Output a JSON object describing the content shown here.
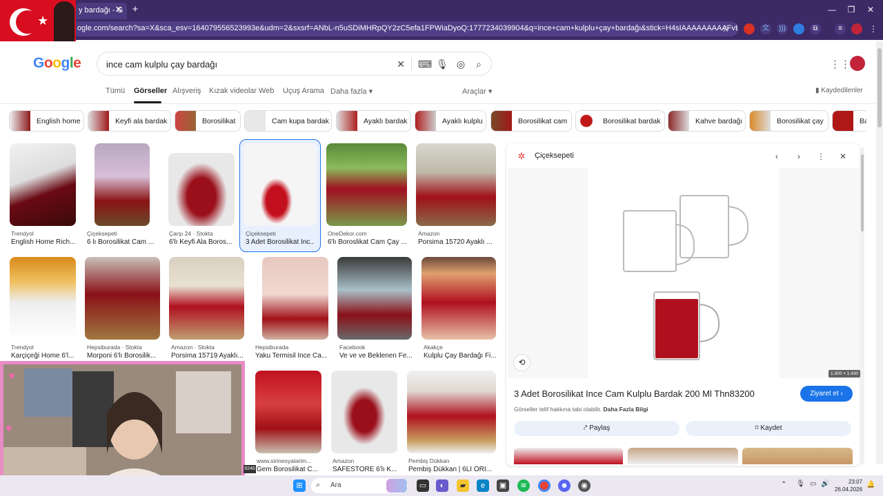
{
  "browser": {
    "tab_title": "y bardağı - G",
    "tab_close": "✕",
    "new_tab": "+",
    "url": "ogle.com/search?sa=X&sca_esv=164079556523993e&udm=2&sxsrf=ANbL-n5uSDiMHRpQY2zC5efa1FPWiaDyoQ:1777234039904&q=ince+cam+kulplu+çay+bardağı&stick=H4sIAAAAAAAAAFvEKpeZl5yqkJyYq5BdmlOQU6...",
    "win_minimize": "—",
    "win_restore": "❐",
    "win_close": "✕"
  },
  "google": {
    "logo_letters": [
      "G",
      "o",
      "o",
      "g",
      "l",
      "e"
    ],
    "logo_colors": [
      "#4285f4",
      "#ea4335",
      "#fbbc05",
      "#4285f4",
      "#34a853",
      "#ea4335"
    ],
    "query": "ince cam kulplu çay bardağı",
    "nav_tabs": [
      "Tümü",
      "Görseller",
      "Alışveriş",
      "Kızak videolar",
      "Web",
      "Uçuş Arama",
      "Daha fazla ▾"
    ],
    "tools": "Araçlar ▾",
    "saved": "Kaydedilenler"
  },
  "chips": [
    "English home",
    "Keyfi ala bardak",
    "Borosilikat",
    "Cam kupa bardak",
    "Ayaklı bardak",
    "Ayaklı kulplu",
    "Borosilikat cam",
    "Borosilikat bardak",
    "Kahve bardağı",
    "Borosilikat çay",
    "Ba"
  ],
  "results": [
    {
      "source": "Trendyol",
      "title": "English Home Rich..."
    },
    {
      "source": "Çiçeksepeti",
      "title": "6 lı Borosilikat Cam ..."
    },
    {
      "source": "Çarşı 24 · Stokta",
      "title": "6'lı Keyfi Ala Boros..."
    },
    {
      "source": "Çiçeksepeti",
      "title": "3 Adet Borosilikat Inc..."
    },
    {
      "source": "OneDekor.com",
      "title": "6'lı Boroslikat Cam Çay ..."
    },
    {
      "source": "Amazon",
      "title": "Porsima 15720 Ayaklı ..."
    },
    {
      "source": "Trendyol",
      "title": "Karçiçeği Home 6'l..."
    },
    {
      "source": "Hepsiburada · Stokta",
      "title": "Morponi 6'lı Borosilik..."
    },
    {
      "source": "Amazon · Stokta",
      "title": "Porsima 15719 Ayaklı..."
    },
    {
      "source": "Hepsiburada",
      "title": "Yaku Termisil Ince Ca..."
    },
    {
      "source": "Facebook",
      "title": "Ve ve ve Beklenen Fe..."
    },
    {
      "source": "Akakçe",
      "title": "Kulplu Çay Bardağı Fi..."
    },
    {
      "source": "www.sirinesyalarim...",
      "title": "Gem Borosilikat C..."
    },
    {
      "source": "Amazon",
      "title": "SAFESTORE 6'lı K..."
    },
    {
      "source": "Pembiş Dükkan",
      "title": "Pembiş Dükkan | 6LI ORİ..."
    }
  ],
  "panel": {
    "site": "Çiçeksepeti",
    "title": "3 Adet Borosilikat Ince Cam Kulplu Bardak 200 Ml Thn83200",
    "copyright": "Görseller telif hakkına tabi olabilir.",
    "more_info": "Daha Fazla Bilgi",
    "visit": "Ziyaret et ›",
    "share": "Paylaş",
    "save": "Kaydet",
    "dims": "1.300 × 1.430"
  },
  "taskbar": {
    "search": "Ara",
    "time": "23:07",
    "date": "26.04.2026",
    "badge": "9246"
  }
}
